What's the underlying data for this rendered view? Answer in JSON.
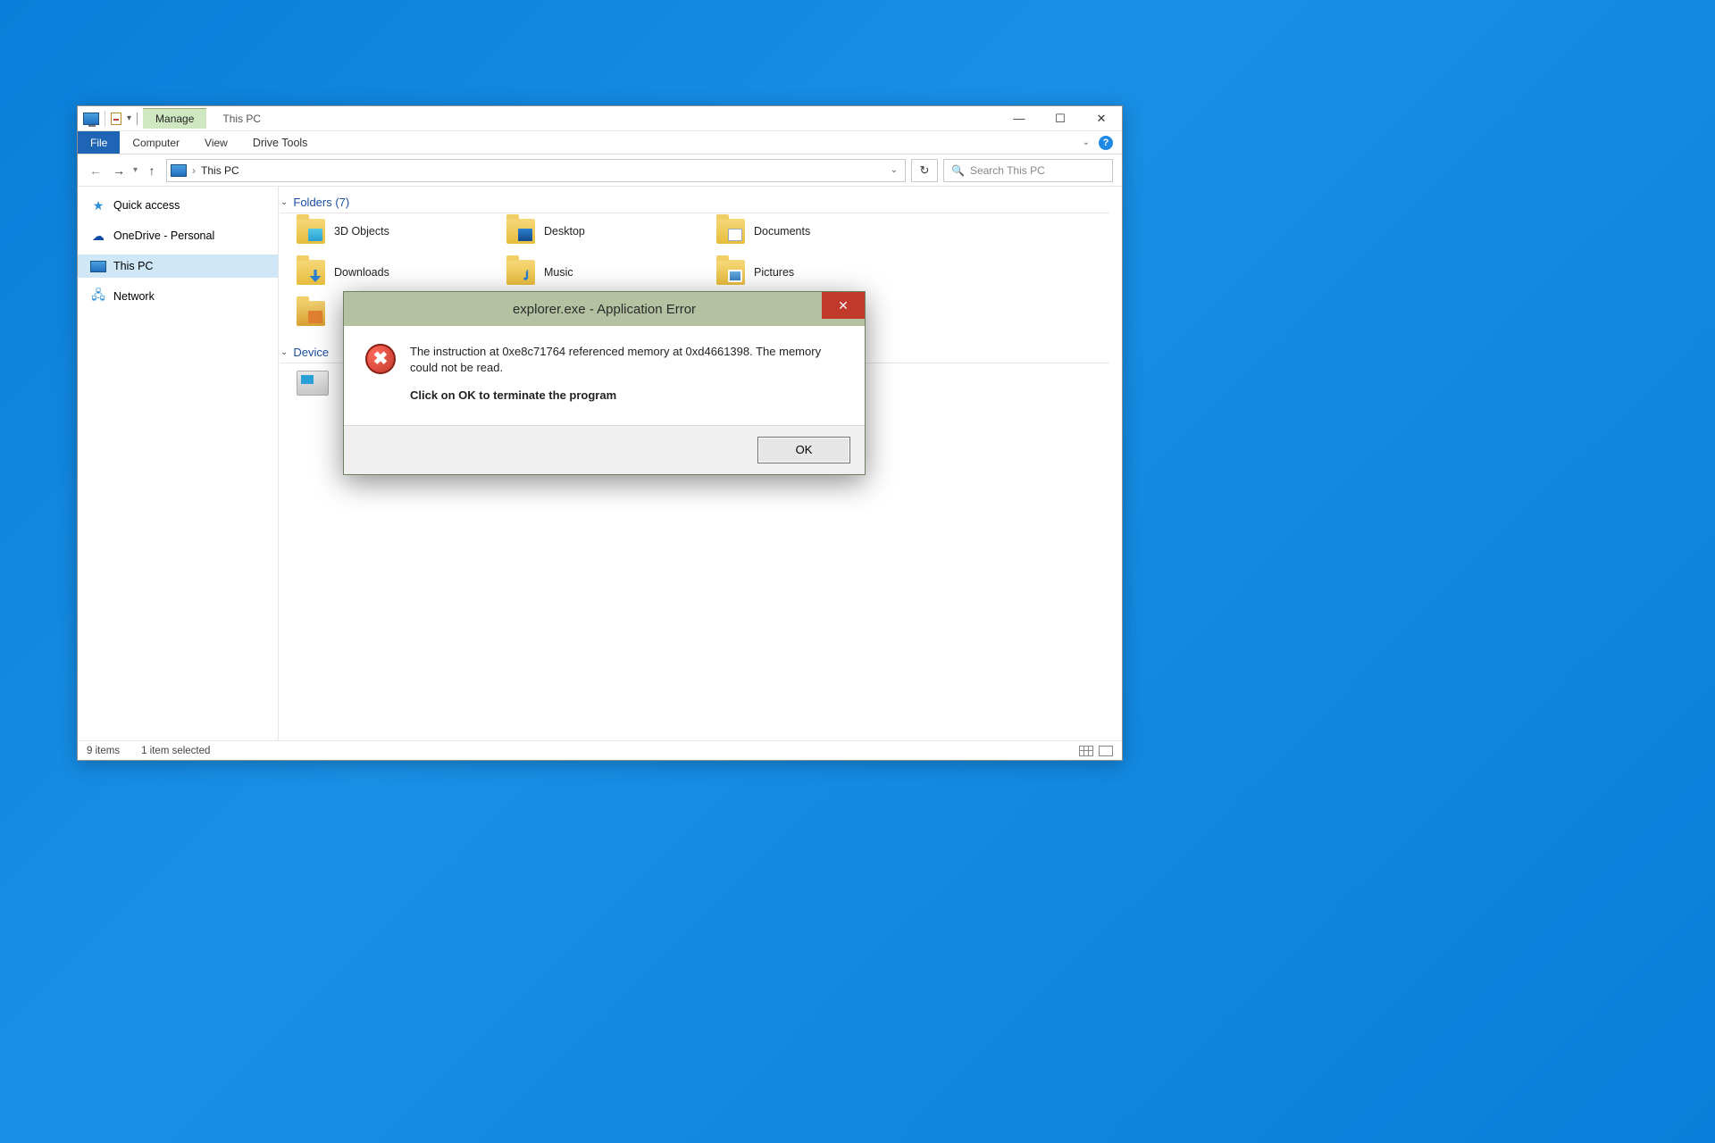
{
  "titlebar": {
    "manage_tab": "Manage",
    "title_tab": "This PC"
  },
  "ribbon": {
    "file": "File",
    "computer": "Computer",
    "view": "View",
    "drive_tools": "Drive Tools"
  },
  "address": {
    "crumb": "This PC"
  },
  "search": {
    "placeholder": "Search This PC"
  },
  "sidebar": {
    "quick_access": "Quick access",
    "onedrive": "OneDrive - Personal",
    "this_pc": "This PC",
    "network": "Network"
  },
  "sections": {
    "folders_label": "Folders (7)",
    "devices_label": "Device"
  },
  "folders": {
    "obj3d": "3D Objects",
    "desktop": "Desktop",
    "documents": "Documents",
    "downloads": "Downloads",
    "music": "Music",
    "pictures": "Pictures"
  },
  "status": {
    "items": "9 items",
    "selected": "1 item selected"
  },
  "dialog": {
    "title": "explorer.exe - Application Error",
    "line1": "The instruction at 0xe8c71764 referenced memory at 0xd4661398. The memory could not be read.",
    "line2": "Click on OK to terminate the program",
    "ok": "OK"
  }
}
